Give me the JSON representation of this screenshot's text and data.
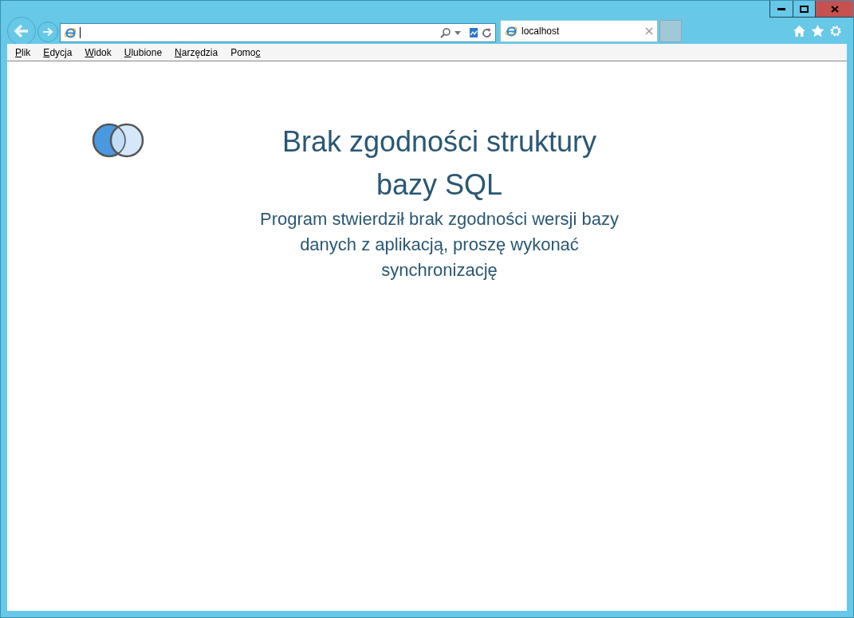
{
  "tabs": [
    {
      "label": "localhost",
      "selected": true
    }
  ],
  "menu": [
    {
      "key": "P",
      "after": "lik"
    },
    {
      "key": "E",
      "after": "dycja"
    },
    {
      "key": "W",
      "after": "idok"
    },
    {
      "key": "U",
      "after": "lubione"
    },
    {
      "key": "N",
      "after": "arzędzia"
    },
    {
      "before": "Pomo",
      "key": "c"
    }
  ],
  "page": {
    "title": "Brak zgodności struktury bazy SQL",
    "message": "Program stwierdził brak zgodności wersji bazy danych z aplikacją, proszę wykonać synchronizację"
  }
}
